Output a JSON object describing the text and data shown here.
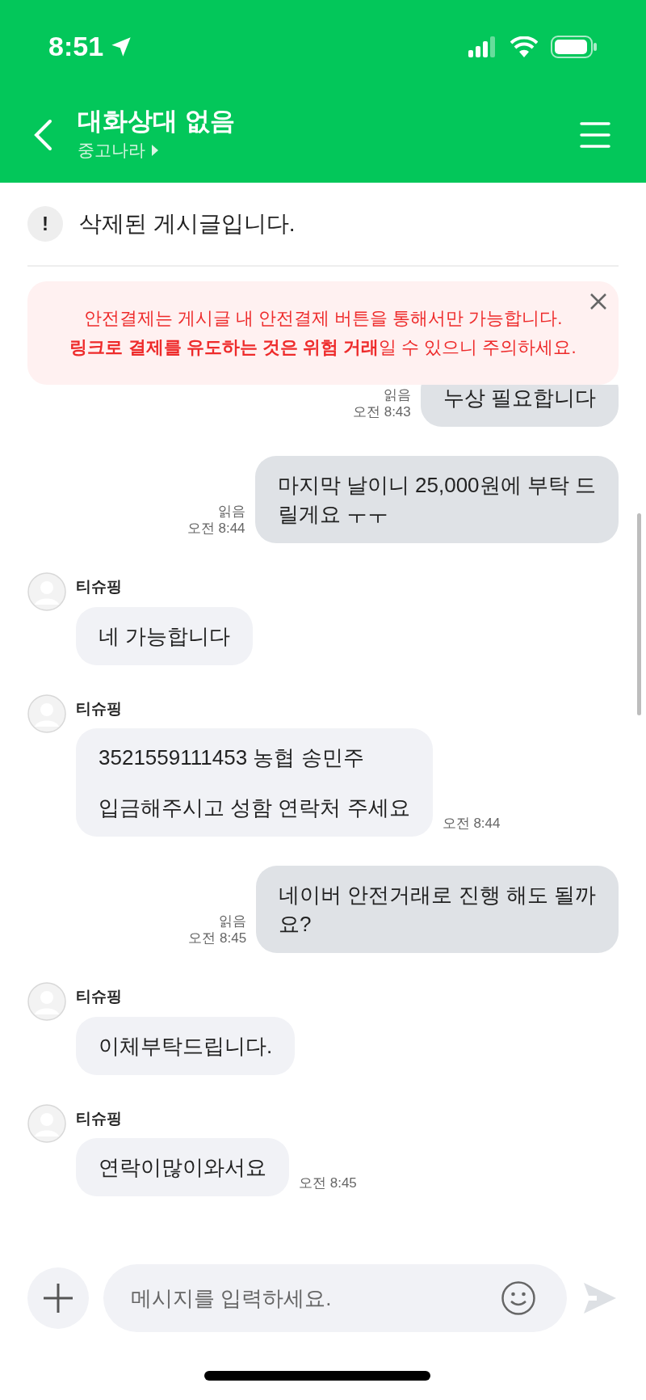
{
  "status_bar": {
    "time": "8:51"
  },
  "header": {
    "title": "대화상대 없음",
    "subtitle": "중고나라"
  },
  "notice": {
    "icon": "!",
    "text": "삭제된 게시글입니다."
  },
  "warning": {
    "lines": [
      "안전결제는 게시글 내 안전결제 버튼을 통해서만 가능합니다.",
      "**링크로 결제를 유도하는 것은 위험 거래**일 수 있으니 주의하세요."
    ]
  },
  "messages": [
    {
      "kind": "mine",
      "lines": [
        "누상 필요합니다"
      ],
      "read": "읽음",
      "time": "오전 8:43",
      "cut": true
    },
    {
      "kind": "mine",
      "lines": [
        "마지막 날이니 25,000원에 부탁 드",
        "릴게요  ㅜㅜ"
      ],
      "read": "읽음",
      "time": "오전 8:44"
    },
    {
      "kind": "theirs",
      "name": "티슈핑",
      "paragraphs": [
        "네 가능합니다"
      ]
    },
    {
      "kind": "theirs",
      "name": "티슈핑",
      "paragraphs": [
        "3521559111453 농협 송민주",
        "입금해주시고 성함 연락처 주세요"
      ],
      "time": "오전 8:44"
    },
    {
      "kind": "mine",
      "lines": [
        "네이버 안전거래로 진행 해도 될까",
        "요?"
      ],
      "read": "읽음",
      "time": "오전 8:45"
    },
    {
      "kind": "theirs",
      "name": "티슈핑",
      "paragraphs": [
        "이체부탁드립니다."
      ]
    },
    {
      "kind": "theirs",
      "name": "티슈핑",
      "paragraphs": [
        "연락이많이와서요"
      ],
      "time": "오전 8:45"
    }
  ],
  "composer": {
    "placeholder": "메시지를 입력하세요."
  }
}
